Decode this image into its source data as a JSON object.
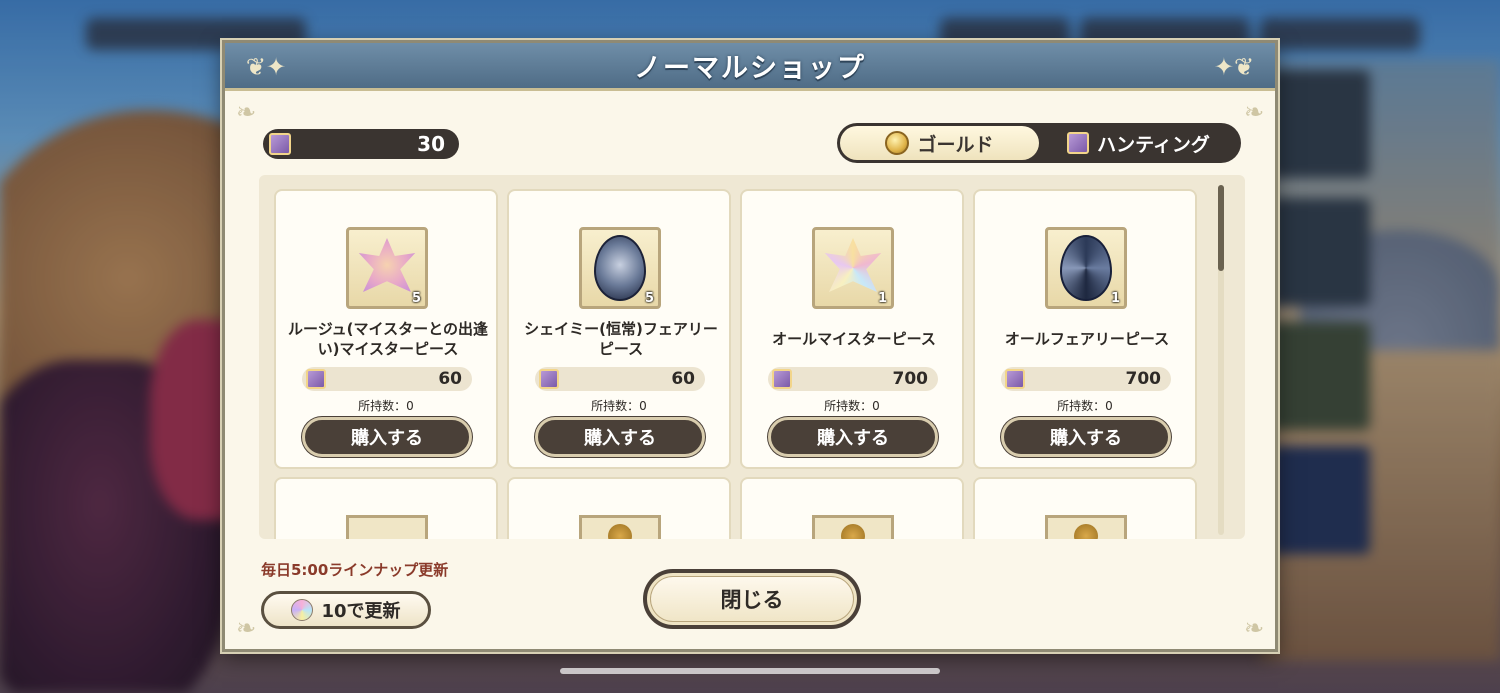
{
  "shop": {
    "title": "ノーマルショップ",
    "currency_value": "30",
    "tabs": [
      {
        "label": "ゴールド",
        "icon": "gold-coin-icon",
        "active": true
      },
      {
        "label": "ハンティング",
        "icon": "hunting-ticket-icon",
        "active": false
      }
    ],
    "items": [
      {
        "name": "ルージュ(マイスターとの出逢い)マイスターピース",
        "count": "5",
        "price": "60",
        "owned": "所持数：0",
        "buy_label": "購入する",
        "icon": "meister-piece-icon",
        "color": "#f0c8e8"
      },
      {
        "name": "シェイミー(恒常)フェアリーピース",
        "count": "5",
        "price": "60",
        "owned": "所持数：0",
        "buy_label": "購入する",
        "icon": "fairy-piece-icon",
        "color": "#5a6a88"
      },
      {
        "name": "オールマイスターピース",
        "count": "1",
        "price": "700",
        "owned": "所持数：0",
        "buy_label": "購入する",
        "icon": "all-meister-piece-icon",
        "color": "#f3d8a0"
      },
      {
        "name": "オールフェアリーピース",
        "count": "1",
        "price": "700",
        "owned": "所持数：0",
        "buy_label": "購入する",
        "icon": "all-fairy-piece-icon",
        "color": "#3c4c6c"
      }
    ],
    "update_note": "毎日5:00ラインナップ更新",
    "refresh_label": "10で更新",
    "close_label": "閉じる"
  }
}
